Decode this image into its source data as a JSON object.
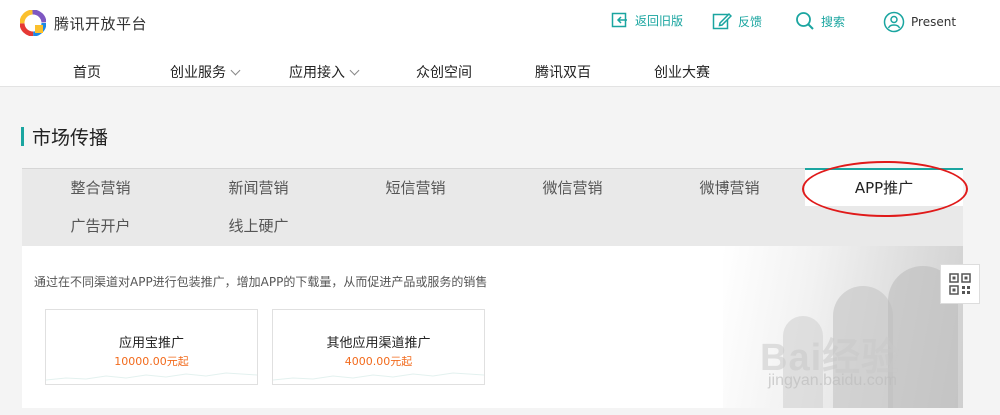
{
  "brand": {
    "name": "腾讯开放平台"
  },
  "top_actions": [
    {
      "label": "返回旧版",
      "icon": "back-old-version-icon"
    },
    {
      "label": "反馈",
      "icon": "feedback-edit-icon"
    },
    {
      "label": "搜索",
      "icon": "search-icon"
    },
    {
      "label": "Present",
      "icon": "user-icon"
    }
  ],
  "nav": [
    {
      "label": "首页"
    },
    {
      "label": "创业服务",
      "dropdown": true
    },
    {
      "label": "应用接入",
      "dropdown": true
    },
    {
      "label": "众创空间"
    },
    {
      "label": "腾讯双百"
    },
    {
      "label": "创业大赛"
    }
  ],
  "section": {
    "title": "市场传播"
  },
  "tabs": [
    {
      "label": "整合营销",
      "active": false
    },
    {
      "label": "新闻营销",
      "active": false
    },
    {
      "label": "短信营销",
      "active": false
    },
    {
      "label": "微信营销",
      "active": false
    },
    {
      "label": "微博营销",
      "active": false
    },
    {
      "label": "APP推广",
      "active": true
    },
    {
      "label": "广告开户",
      "active": false
    },
    {
      "label": "线上硬广",
      "active": false
    }
  ],
  "content": {
    "description": "通过在不同渠道对APP进行包装推广，增加APP的下载量，从而促进产品或服务的销售",
    "cards": [
      {
        "name": "应用宝推广",
        "price": "10000.00元起"
      },
      {
        "name": "其他应用渠道推广",
        "price": "4000.00元起"
      }
    ]
  },
  "watermark": {
    "text": "Bai经验",
    "url": "jingyan.baidu.com"
  },
  "colors": {
    "accent": "#1aa5a0",
    "price": "#f26b1d",
    "annotation": "#e01a1a"
  }
}
